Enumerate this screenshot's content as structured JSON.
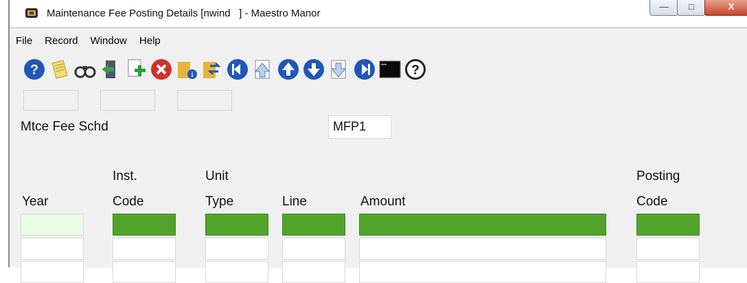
{
  "window": {
    "title": "Maintenance Fee Posting Details [nwind   ] - Maestro Manor",
    "min_glyph": "—",
    "max_glyph": "□",
    "close_glyph": "X"
  },
  "menu": [
    "File",
    "Record",
    "Window",
    "Help"
  ],
  "toolbar": [
    {
      "name": "help-icon",
      "color": "#1f57b8"
    },
    {
      "name": "notes-icon",
      "color": "#e9d15a"
    },
    {
      "name": "binoculars-icon",
      "color": "#444444"
    },
    {
      "name": "exit-door-icon",
      "color": "#2f8a3a"
    },
    {
      "name": "add-record-icon",
      "color": "#2f9e2f"
    },
    {
      "name": "delete-icon",
      "color": "#d23030"
    },
    {
      "name": "info-folder-icon",
      "color": "#e7b53a"
    },
    {
      "name": "refresh-folder-icon",
      "color": "#e7b53a"
    },
    {
      "name": "first-record-icon",
      "color": "#1f57b8"
    },
    {
      "name": "page-up-icon",
      "color": "#7a9bc8"
    },
    {
      "name": "previous-record-icon",
      "color": "#1f57b8"
    },
    {
      "name": "next-record-icon",
      "color": "#1f57b8"
    },
    {
      "name": "page-down-icon",
      "color": "#7a9bc8"
    },
    {
      "name": "last-record-icon",
      "color": "#1f57b8"
    },
    {
      "name": "console-icon",
      "color": "#111111"
    },
    {
      "name": "context-help-icon",
      "color": "#222222"
    }
  ],
  "form": {
    "schedule_label": "Mtce Fee Schd",
    "schedule_value": "MFP1"
  },
  "grid": {
    "headers": {
      "year": "Year",
      "inst_code_1": "Inst.",
      "inst_code_2": "Code",
      "unit_type_1": "Unit",
      "unit_type_2": "Type",
      "line": "Line",
      "amount": "Amount",
      "posting_code_1": "Posting",
      "posting_code_2": "Code"
    }
  }
}
